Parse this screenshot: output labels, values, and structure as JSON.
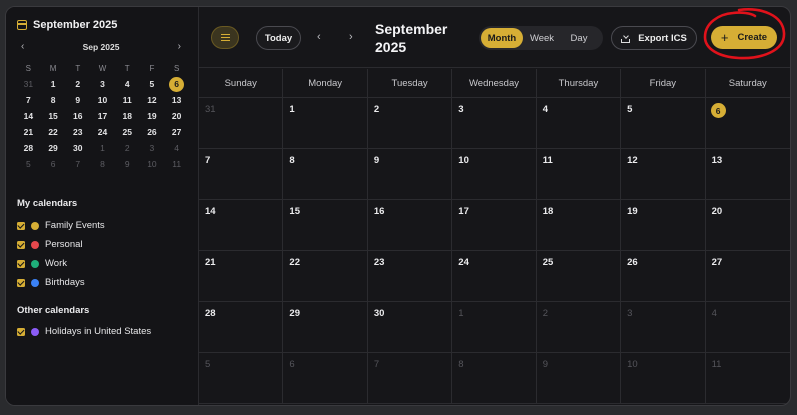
{
  "sidebar": {
    "title": "September 2025",
    "mini_calendar": {
      "month_label": "Sep 2025",
      "prev": "‹",
      "next": "›",
      "weekdays": [
        "S",
        "M",
        "T",
        "W",
        "T",
        "F",
        "S"
      ],
      "weeks": [
        [
          "31",
          "1",
          "2",
          "3",
          "4",
          "5",
          "6"
        ],
        [
          "7",
          "8",
          "9",
          "10",
          "11",
          "12",
          "13"
        ],
        [
          "14",
          "15",
          "16",
          "17",
          "18",
          "19",
          "20"
        ],
        [
          "21",
          "22",
          "23",
          "24",
          "25",
          "26",
          "27"
        ],
        [
          "28",
          "29",
          "30",
          "1",
          "2",
          "3",
          "4"
        ],
        [
          "5",
          "6",
          "7",
          "8",
          "9",
          "10",
          "11"
        ]
      ],
      "today": "6"
    },
    "my_calendars_title": "My calendars",
    "my_calendars": [
      {
        "label": "Family Events",
        "color": "#d6ae35"
      },
      {
        "label": "Personal",
        "color": "#e5484d"
      },
      {
        "label": "Work",
        "color": "#1fae7a"
      },
      {
        "label": "Birthdays",
        "color": "#3b82f6"
      }
    ],
    "other_calendars_title": "Other calendars",
    "other_calendars": [
      {
        "label": "Holidays in United States",
        "color": "#8b5cf6"
      }
    ]
  },
  "toolbar": {
    "today_label": "Today",
    "prev": "‹",
    "next": "›",
    "title_line1": "September",
    "title_line2": "2025",
    "views": [
      "Month",
      "Week",
      "Day"
    ],
    "active_view": "Month",
    "export_label": "Export ICS",
    "create_plus": "+",
    "create_label": "Create"
  },
  "calendar": {
    "weekdays": [
      "Sunday",
      "Monday",
      "Tuesday",
      "Wednesday",
      "Thursday",
      "Friday",
      "Saturday"
    ],
    "weeks": [
      [
        "31",
        "1",
        "2",
        "3",
        "4",
        "5",
        "6"
      ],
      [
        "7",
        "8",
        "9",
        "10",
        "11",
        "12",
        "13"
      ],
      [
        "14",
        "15",
        "16",
        "17",
        "18",
        "19",
        "20"
      ],
      [
        "21",
        "22",
        "23",
        "24",
        "25",
        "26",
        "27"
      ],
      [
        "28",
        "29",
        "30",
        "1",
        "2",
        "3",
        "4"
      ],
      [
        "5",
        "6",
        "7",
        "8",
        "9",
        "10",
        "11"
      ]
    ],
    "today": "6"
  },
  "colors": {
    "accent": "#d6ae35",
    "background": "#161619",
    "annotation": "#e0121b"
  }
}
